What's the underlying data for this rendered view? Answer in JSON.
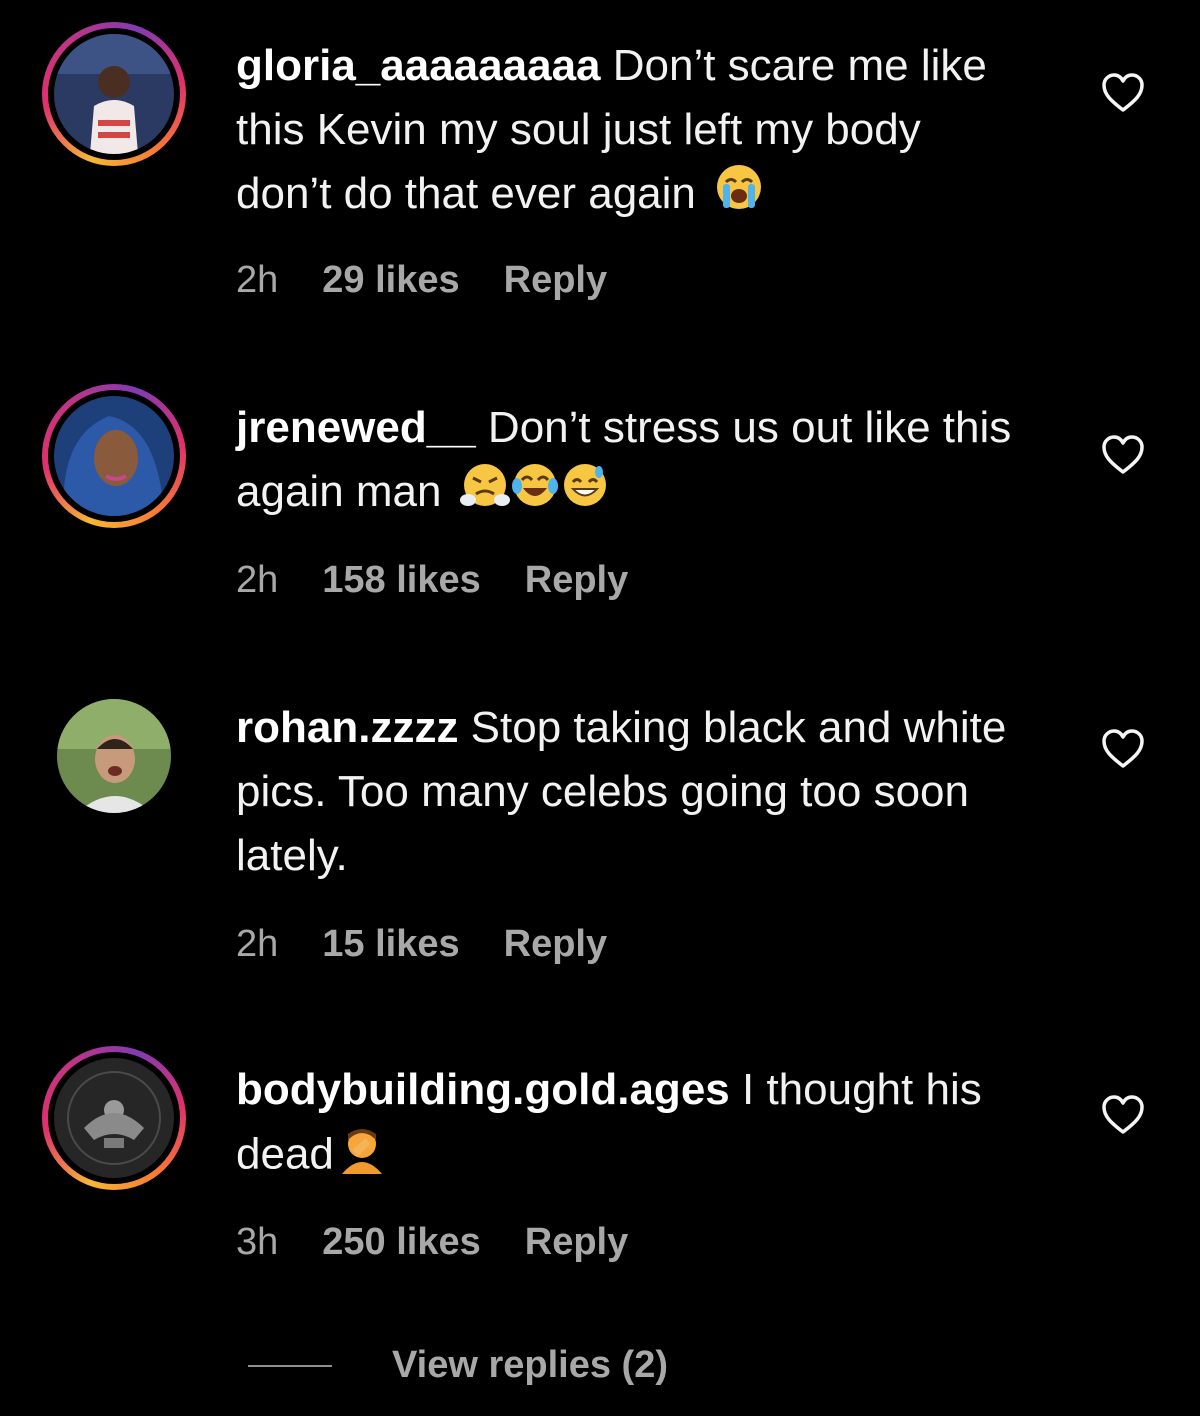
{
  "comments": [
    {
      "username": "gloria_aaaaaaaaa",
      "text": " Don’t scare me like this Kevin my soul just left my body don’t do that ever again",
      "time": "2h",
      "likes": "29 likes",
      "reply": "Reply",
      "emojis": [
        "loudly-crying-face-emoji"
      ]
    },
    {
      "username": "jrenewed__",
      "text": " Don’t stress us out like this again man",
      "time": "2h",
      "likes": "158 likes",
      "reply": "Reply",
      "emojis": [
        "face-with-steam-emoji",
        "tears-of-joy-emoji",
        "grinning-sweat-emoji"
      ]
    },
    {
      "username": "rohan.zzzz",
      "text": " Stop taking black and white pics. Too many celebs going too soon lately.",
      "time": "2h",
      "likes": "15 likes",
      "reply": "Reply",
      "emojis": []
    },
    {
      "username": "bodybuilding.gold.ages",
      "text": " I thought his dead",
      "time": "3h",
      "likes": "250 likes",
      "reply": "Reply",
      "emojis": [
        "facepalm-emoji"
      ]
    }
  ],
  "view_replies": "View replies (2)",
  "colors": {
    "background": "#000000",
    "text": "#f2f2f2",
    "muted": "#a8a8a8",
    "story_ring": [
      "#f7b733",
      "#e1306c",
      "#833ab4"
    ]
  }
}
